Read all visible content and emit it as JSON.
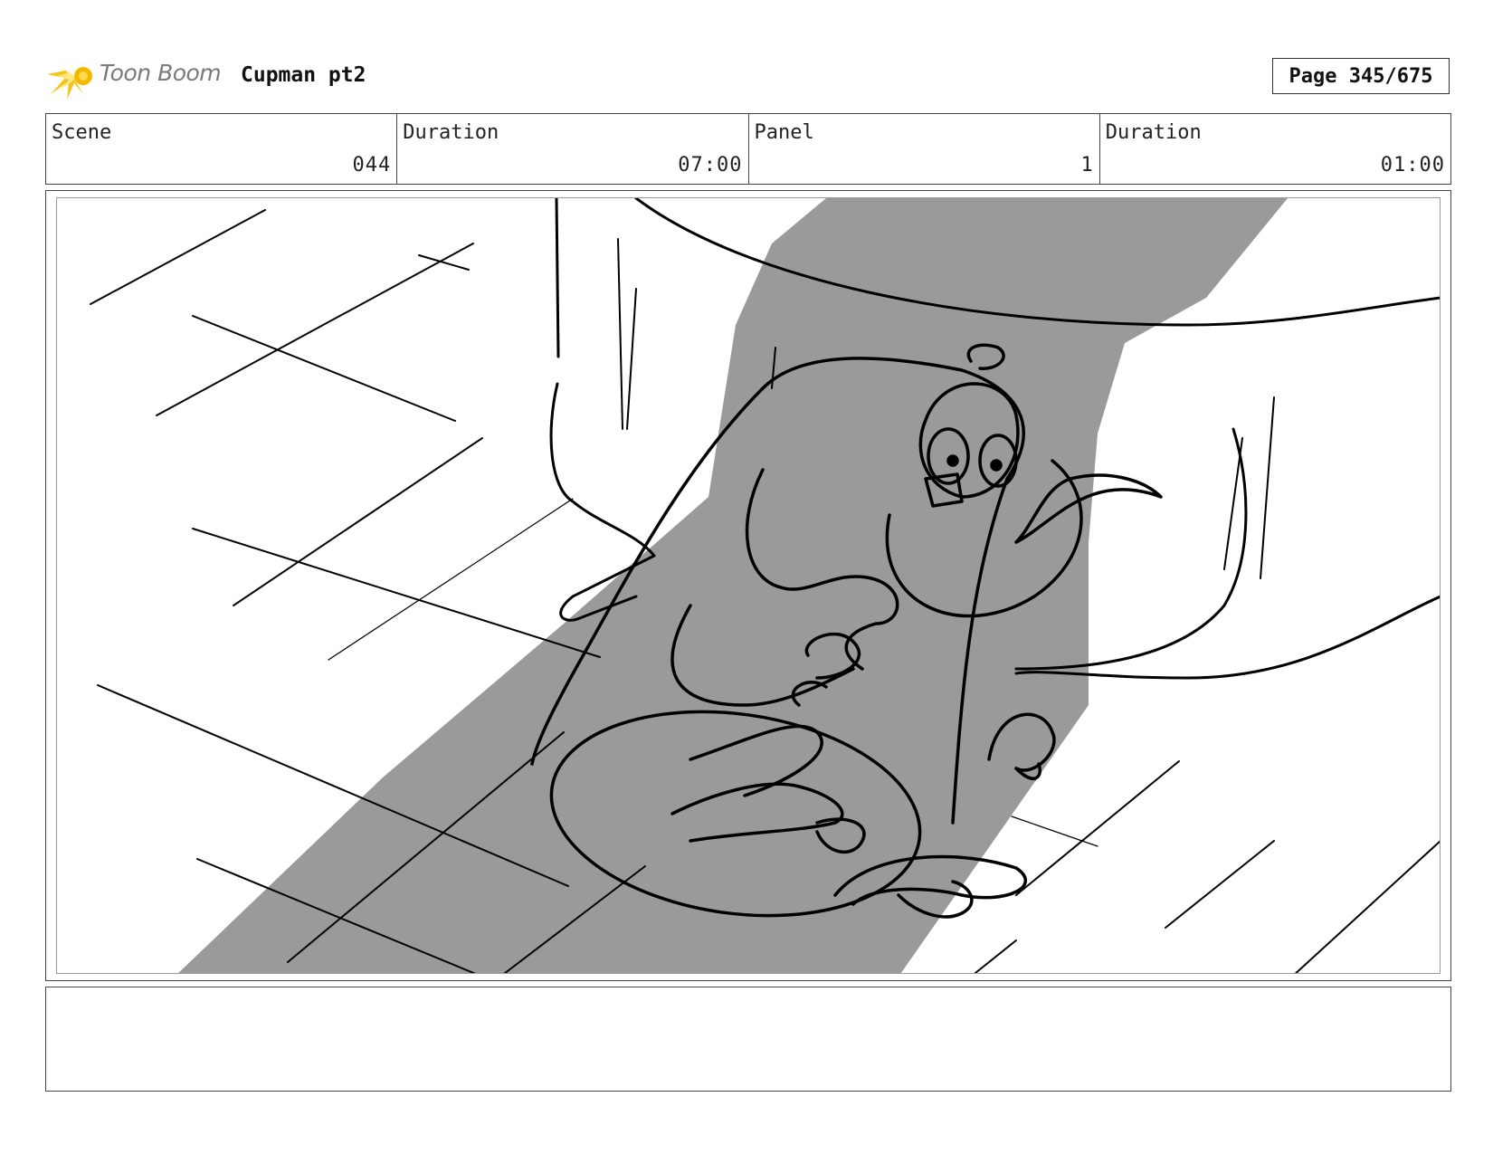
{
  "header": {
    "logo_text": "Toon Boom",
    "project_title": "Cupman pt2",
    "page_label": "Page 345/675"
  },
  "info": {
    "scene_label": "Scene",
    "scene_value": "044",
    "scene_duration_label": "Duration",
    "scene_duration_value": "07:00",
    "panel_label": "Panel",
    "panel_value": "1",
    "panel_duration_label": "Duration",
    "panel_duration_value": "01:00"
  },
  "panel": {
    "image_icon": "storyboard-sketch",
    "shadow_color": "#9a9a9a"
  },
  "notes": {
    "text": ""
  }
}
